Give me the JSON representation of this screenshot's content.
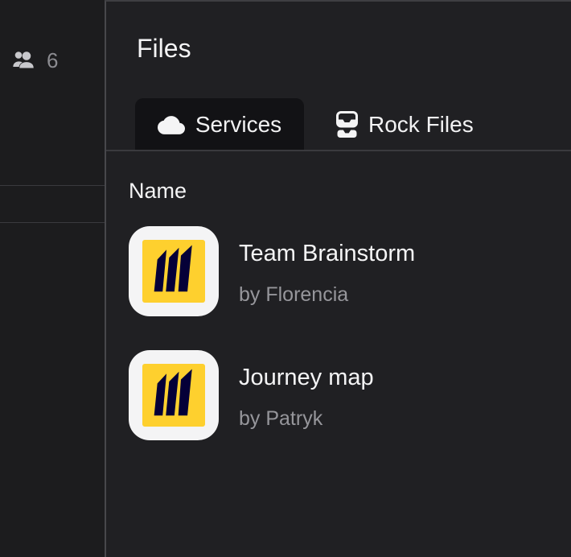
{
  "colors": {
    "sidebar_bg": "#1c1c1e",
    "panel_bg": "#202023",
    "panel_border": "#47474b",
    "active_tab_bg": "#121215",
    "divider": "#3a3a3e",
    "text_primary": "#f4f4f5",
    "text_secondary": "#96969b",
    "miro_yellow": "#fed02e",
    "miro_navy": "#050038",
    "card_bg": "#f4f4f5"
  },
  "sidebar": {
    "participants_icon": "people-icon",
    "participants_count": "6"
  },
  "panel": {
    "title": "Files",
    "tabs": [
      {
        "label": "Services",
        "icon": "cloud-icon",
        "active": true
      },
      {
        "label": "Rock Files",
        "icon": "archive-box-icon",
        "active": false
      }
    ],
    "table": {
      "name_header": "Name",
      "rows": [
        {
          "icon": "miro-board-icon",
          "title": "Team Brainstorm",
          "byline": "by Florencia"
        },
        {
          "icon": "miro-board-icon",
          "title": "Journey map",
          "byline": "by Patryk"
        }
      ]
    }
  }
}
